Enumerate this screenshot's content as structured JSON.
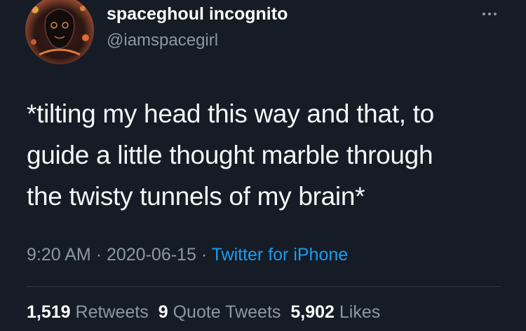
{
  "author": {
    "display_name": "spaceghoul incognito",
    "handle": "@iamspacegirl"
  },
  "tweet": {
    "lines": [
      "*tilting my head this way and that, to",
      "guide a little thought marble through",
      "the twisty tunnels of my brain*"
    ],
    "time": "9:20 AM",
    "date": "2020-06-15",
    "separator": "·",
    "source": "Twitter for iPhone"
  },
  "stats": {
    "retweets_count": "1,519",
    "retweets_label": "Retweets",
    "quotes_count": "9",
    "quotes_label": "Quote Tweets",
    "likes_count": "5,902",
    "likes_label": "Likes"
  },
  "icons": {
    "more": "more-horizontal-icon"
  },
  "colors": {
    "background": "#151c26",
    "secondary_text": "#8b98a5",
    "link": "#1d9bf0"
  }
}
